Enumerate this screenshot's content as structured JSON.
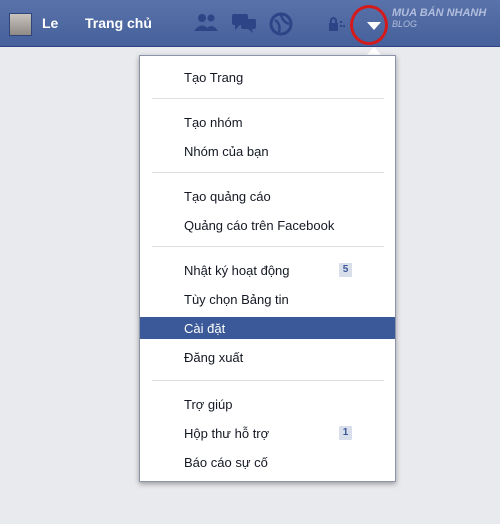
{
  "colors": {
    "topbar": "#4f67a0",
    "active_item": "#3b5998",
    "highlight_ring": "#d41a1a"
  },
  "topbar": {
    "profile_name": "Le",
    "home_label": "Trang chủ",
    "icons": [
      "friend-requests-icon",
      "messages-icon",
      "notifications-icon",
      "privacy-lock-icon",
      "account-menu-caret-icon"
    ],
    "watermark_main": "MUA BÁN NHANH",
    "watermark_sub": "BLOG"
  },
  "menu": {
    "items": [
      {
        "label": "Tạo Trang"
      },
      {
        "label": "Tạo nhóm"
      },
      {
        "label": "Nhóm của bạn"
      },
      {
        "label": "Tạo quảng cáo"
      },
      {
        "label": "Quảng cáo trên Facebook"
      },
      {
        "label": "Nhật ký hoạt động",
        "badge": "5"
      },
      {
        "label": "Tùy chọn Bảng tin"
      },
      {
        "label": "Cài đặt",
        "active": true
      },
      {
        "label": "Đăng xuất"
      },
      {
        "label": "Trợ giúp"
      },
      {
        "label": "Hộp thư hỗ trợ",
        "badge": "1"
      },
      {
        "label": "Báo cáo sự cố"
      }
    ]
  }
}
